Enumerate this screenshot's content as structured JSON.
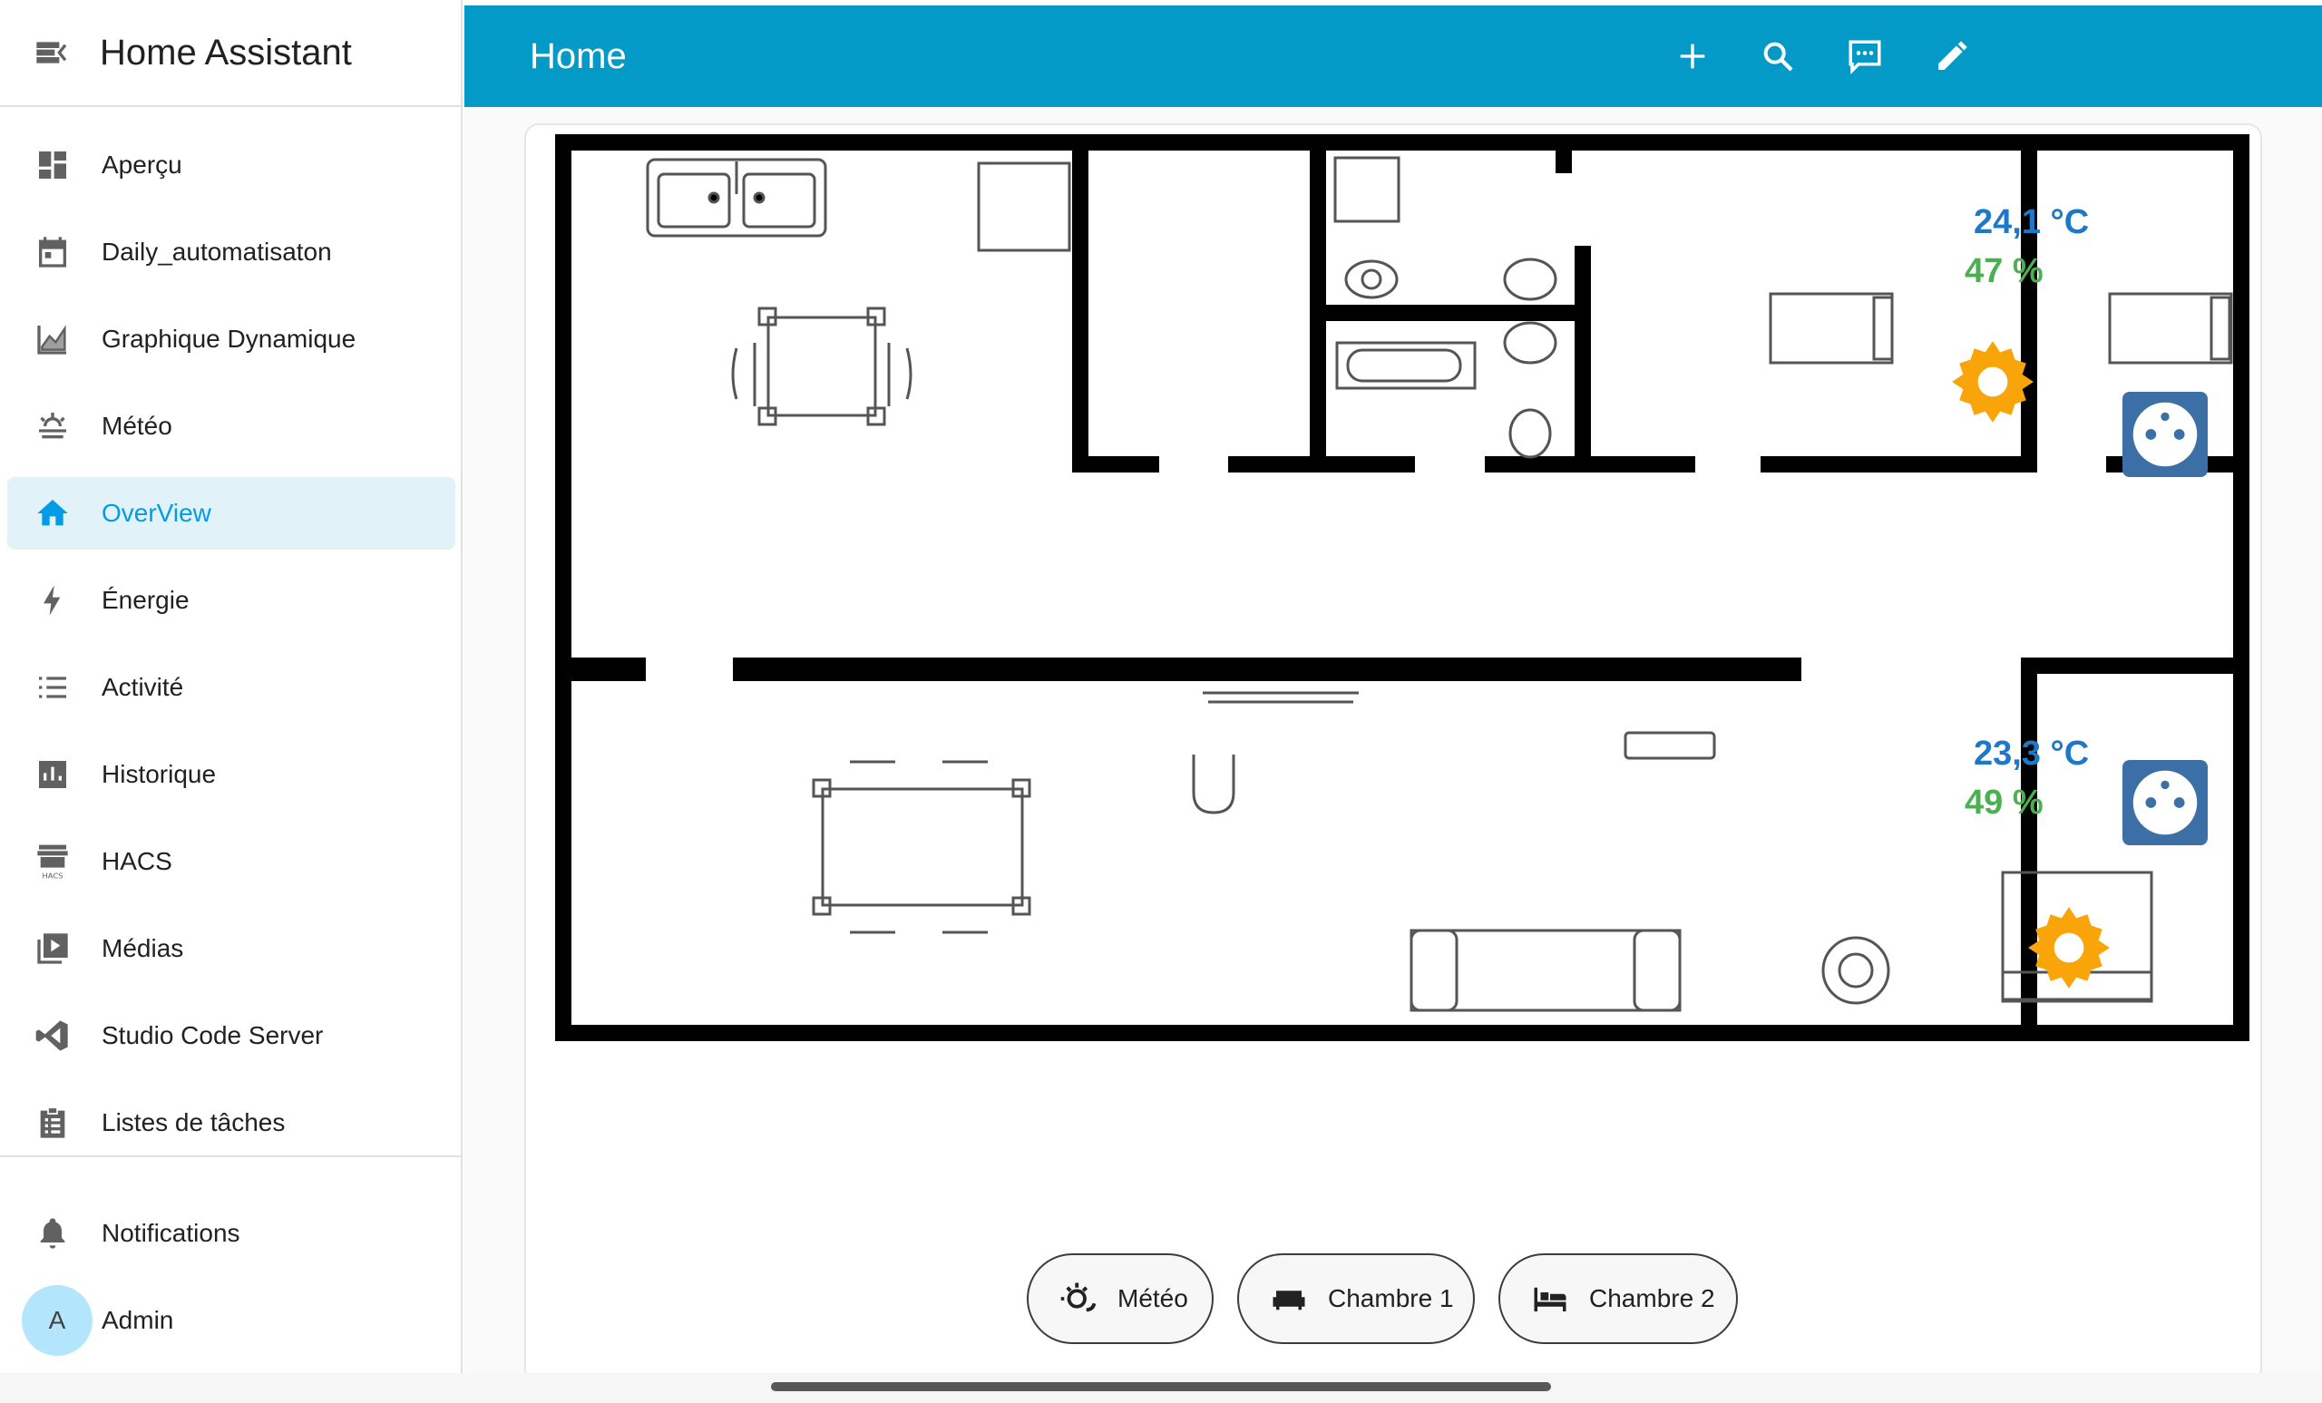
{
  "app": {
    "title": "Home Assistant"
  },
  "sidebar": {
    "items": [
      {
        "label": "Aperçu",
        "icon": "dashboard-icon",
        "active": false
      },
      {
        "label": "Daily_automatisaton",
        "icon": "calendar-icon",
        "active": false
      },
      {
        "label": "Graphique Dynamique",
        "icon": "chart-line-icon",
        "active": false
      },
      {
        "label": "Météo",
        "icon": "weather-icon",
        "active": false
      },
      {
        "label": "OverView",
        "icon": "home-icon",
        "active": true
      },
      {
        "label": "Énergie",
        "icon": "lightning-icon",
        "active": false
      },
      {
        "label": "Activité",
        "icon": "list-icon",
        "active": false
      },
      {
        "label": "Historique",
        "icon": "bar-chart-icon",
        "active": false
      },
      {
        "label": "HACS",
        "icon": "hacs-icon",
        "active": false
      },
      {
        "label": "Médias",
        "icon": "media-icon",
        "active": false
      },
      {
        "label": "Studio Code Server",
        "icon": "vscode-icon",
        "active": false
      },
      {
        "label": "Listes de tâches",
        "icon": "clipboard-list-icon",
        "active": false
      }
    ],
    "bottom": {
      "notifications_label": "Notifications",
      "user_label": "Admin",
      "avatar_letter": "A"
    }
  },
  "topbar": {
    "view_title": "Home"
  },
  "floorplan": {
    "room1": {
      "temperature": "24,1 °C",
      "humidity": "47 %"
    },
    "room2": {
      "temperature": "23,3 °C",
      "humidity": "49 %"
    }
  },
  "chips": [
    {
      "label": "Météo",
      "icon": "weather-sunny-icon"
    },
    {
      "label": "Chambre 1",
      "icon": "sofa-icon"
    },
    {
      "label": "Chambre 2",
      "icon": "bed-icon"
    }
  ],
  "colors": {
    "accent": "#039ac8",
    "temperature": "#1e78c8",
    "humidity": "#4caf50",
    "gear": "#f9a50a",
    "outlet": "#3b6fa5"
  }
}
